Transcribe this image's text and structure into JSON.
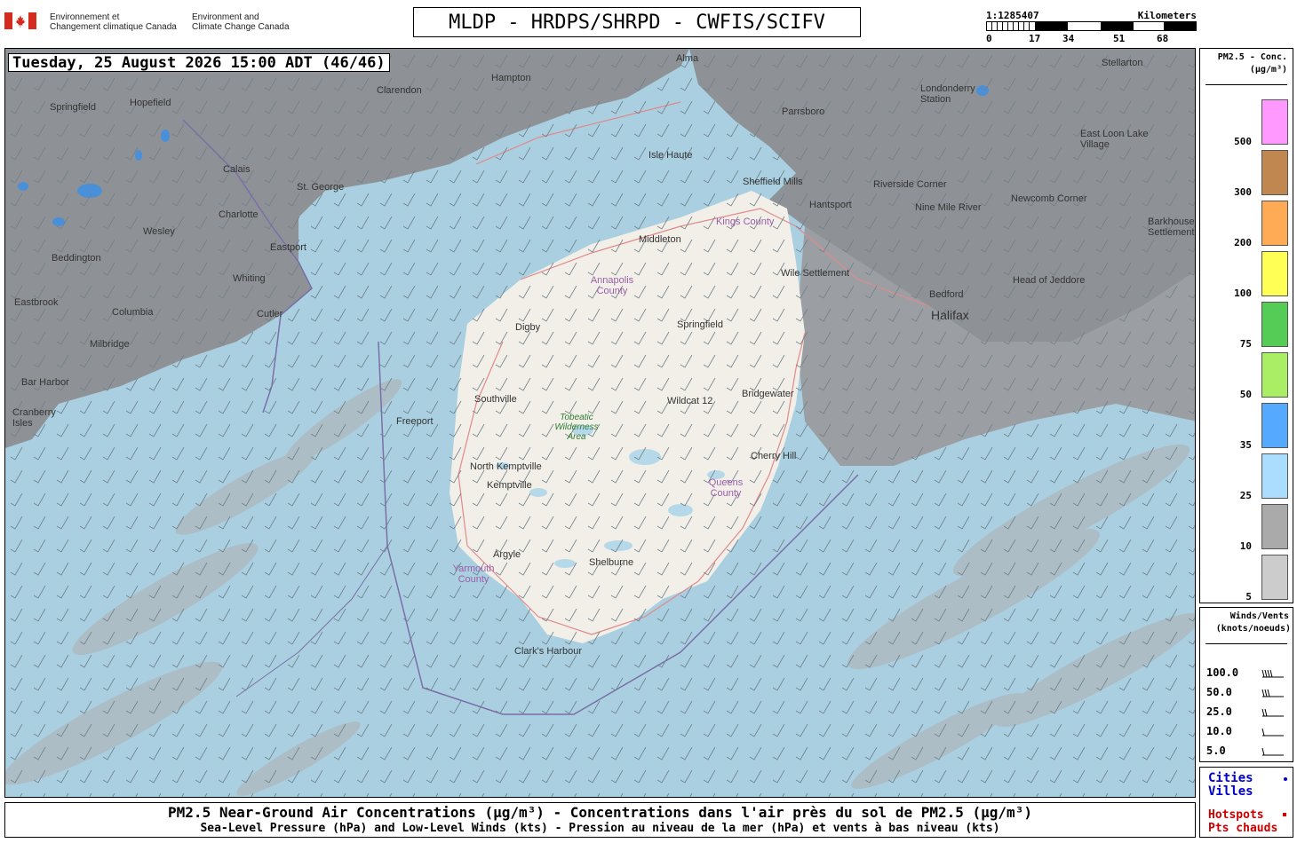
{
  "header": {
    "agency_fr": [
      "Environnement et",
      "Changement climatique Canada"
    ],
    "agency_en": [
      "Environment and",
      "Climate Change Canada"
    ],
    "title": "MLDP - HRDPS/SHRPD - CWFIS/SCIFV"
  },
  "scale": {
    "ratio": "1:1285407",
    "unit": "Kilometers",
    "ticks": [
      "0",
      "17",
      "34",
      "51",
      "68"
    ]
  },
  "map": {
    "timestamp": "Tuesday, 25 August 2026 15:00 ADT (46/46)",
    "places": {
      "alma": "Alma",
      "hampton": "Hampton",
      "clarendon": "Clarendon",
      "springfield_nb": "Springfield",
      "hopefield": "Hopefield",
      "calais": "Calais",
      "st_george": "St. George",
      "charlotte": "Charlotte",
      "wesley": "Wesley",
      "beddington": "Beddington",
      "eastport": "Eastport",
      "whiting": "Whiting",
      "eastbrook": "Eastbrook",
      "columbia": "Columbia",
      "cutler": "Cutler",
      "milbridge": "Milbridge",
      "bar_harbor": "Bar Harbor",
      "cranberry_isles": "Cranberry Isles",
      "parrsboro": "Parrsboro",
      "londonderry_station": "Londonderry Station",
      "stellarton": "Stellarton",
      "isle_haute": "Isle Haute",
      "sheffield_mills": "Sheffield Mills",
      "riverside_corner": "Riverside Corner",
      "east_loon_lake": "East Loon Lake Village",
      "hantsport": "Hantsport",
      "nine_mile_river": "Nine Mile River",
      "newcomb_corner": "Newcomb Corner",
      "barkhouse_settlement": "Barkhouse Settlement",
      "kings_county": "Kings County",
      "middleton": "Middleton",
      "wile_settlement": "Wile Settlement",
      "annapolis_county": "Annapolis County",
      "bedford": "Bedford",
      "head_of_jeddore": "Head of Jeddore",
      "halifax": "Halifax",
      "digby": "Digby",
      "springfield_ns": "Springfield",
      "southville": "Southville",
      "freeport": "Freeport",
      "wildcat": "Wildcat 12",
      "bridgewater": "Bridgewater",
      "tobeatic": "Tobeatic Wilderness Area",
      "cherry_hill": "Cherry Hill",
      "north_kemptville": "North Kemptville",
      "kemptville": "Kemptville",
      "queens_county": "Queens County",
      "argyle": "Argyle",
      "yarmouth_county": "Yarmouth County",
      "shelburne": "Shelburne",
      "clarks_harbour": "Clark's Harbour"
    }
  },
  "pm_legend": {
    "title": "PM2.5 - Conc.",
    "unit": "(µg/m³)",
    "levels": [
      {
        "label": "500",
        "color": "#ff99ff"
      },
      {
        "label": "300",
        "color": "#c08850"
      },
      {
        "label": "200",
        "color": "#ffaa55"
      },
      {
        "label": "100",
        "color": "#ffff55"
      },
      {
        "label": "75",
        "color": "#55cc55"
      },
      {
        "label": "50",
        "color": "#aaee66"
      },
      {
        "label": "35",
        "color": "#55aaff"
      },
      {
        "label": "25",
        "color": "#aaddff"
      },
      {
        "label": "10",
        "color": "#aaaaaa"
      },
      {
        "label": "5",
        "color": "#cccccc"
      }
    ]
  },
  "wind_legend": {
    "title": "Winds/Vents",
    "unit": "(knots/noeuds)",
    "speeds": [
      "100.0",
      "50.0",
      "25.0",
      "10.0",
      "5.0"
    ]
  },
  "markers": {
    "cities_en": "Cities",
    "cities_fr": "Villes",
    "hotspots_en": "Hotspots",
    "hotspots_fr": "Pts chauds",
    "cities_color": "#0000cc",
    "hotspots_color": "#cc0000"
  },
  "caption": {
    "line1": "PM2.5 Near-Ground Air Concentrations (µg/m³) - Concentrations dans l'air près du sol de PM2.5 (µg/m³)",
    "line2": "Sea-Level Pressure (hPa) and Low-Level Winds (kts) - Pression au niveau de la mer (hPa) et vents à bas niveau (kts)"
  }
}
